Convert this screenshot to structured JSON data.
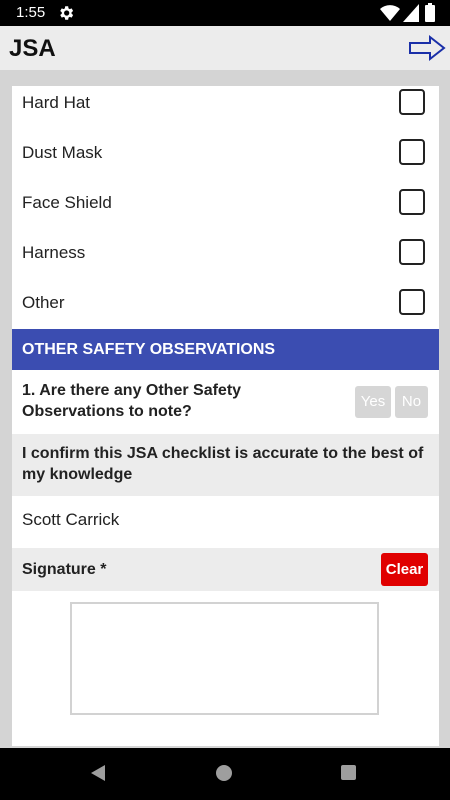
{
  "status": {
    "time": "1:55"
  },
  "app": {
    "title": "JSA",
    "next_icon": "arrow-right-icon"
  },
  "ppe_items": [
    {
      "label": "Hard Hat",
      "checked": false
    },
    {
      "label": "Dust Mask",
      "checked": false
    },
    {
      "label": "Face Shield",
      "checked": false
    },
    {
      "label": "Harness",
      "checked": false
    },
    {
      "label": "Other",
      "checked": false
    }
  ],
  "section": {
    "title": "OTHER SAFETY OBSERVATIONS",
    "color": "#3b4db1"
  },
  "question": {
    "text": "1. Are there any Other Safety Observations to note?",
    "yes_label": "Yes",
    "no_label": "No"
  },
  "confirm": {
    "text": "I confirm this JSA checklist is accurate to the best of my knowledge"
  },
  "signer": {
    "name": "Scott Carrick"
  },
  "signature": {
    "label": "Signature *",
    "clear_label": "Clear",
    "clear_color": "#e00000"
  }
}
